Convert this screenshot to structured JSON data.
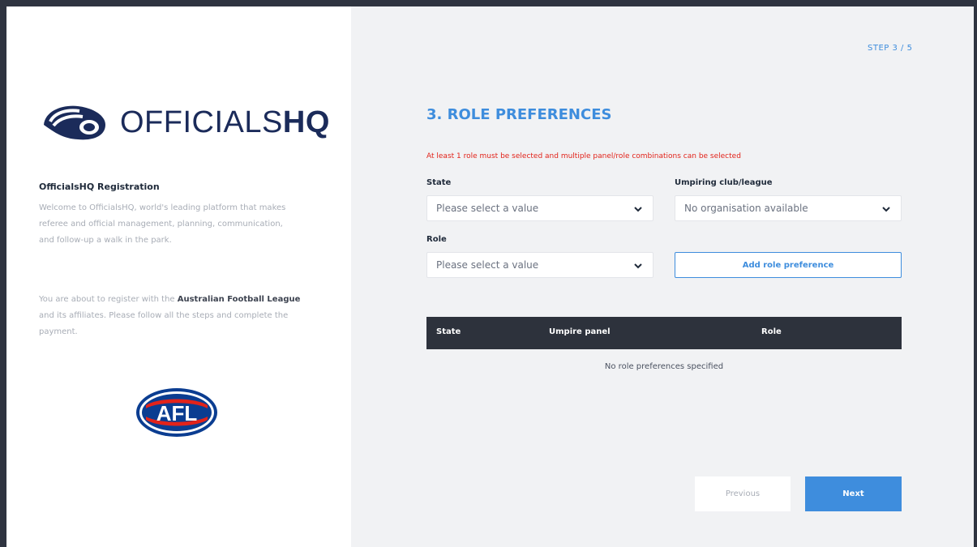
{
  "sidebar": {
    "logo_text_light": "OFFICIALS",
    "logo_text_bold": "HQ",
    "registration_title": "OfficialsHQ Registration",
    "welcome_line1": "Welcome to OfficialsHQ, world's leading platform that makes",
    "welcome_line2": "referee and official management, planning, communication,",
    "welcome_line3": "and follow-up a walk in the park.",
    "register_prefix": "You are about to register with the ",
    "register_org": "Australian Football League",
    "register_line2": "and its affiliates. Please follow all the steps and complete the",
    "register_line3": "payment.",
    "afl_logo_text": "AFL"
  },
  "step_indicator": "STEP 3 / 5",
  "form": {
    "title": "3. ROLE PREFERENCES",
    "warning": "At least 1 role must be selected and multiple panel/role combinations can be selected",
    "state_label": "State",
    "state_value": "Please select a value",
    "club_label": "Umpiring club/league",
    "club_value": "No organisation available",
    "role_label": "Role",
    "role_value": "Please select a value",
    "add_button": "Add role preference"
  },
  "table": {
    "columns": [
      "State",
      "Umpire panel",
      "Role"
    ],
    "empty_message": "No role preferences specified"
  },
  "nav": {
    "previous": "Previous",
    "next": "Next"
  },
  "colors": {
    "accent": "#3e8ddd",
    "warning": "#e2231a",
    "table_header": "#2d323c",
    "brand_navy": "#1b2b5a"
  }
}
